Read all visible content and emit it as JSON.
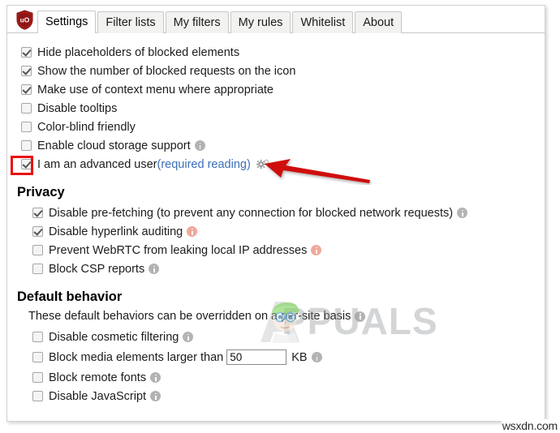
{
  "window": {
    "app_name": "uBlock Origin",
    "logo_icon": "ublock-shield-icon"
  },
  "tabs": [
    {
      "label": "Settings",
      "active": true,
      "name": "tab-settings"
    },
    {
      "label": "Filter lists",
      "active": false,
      "name": "tab-filter-lists"
    },
    {
      "label": "My filters",
      "active": false,
      "name": "tab-my-filters"
    },
    {
      "label": "My rules",
      "active": false,
      "name": "tab-my-rules"
    },
    {
      "label": "Whitelist",
      "active": false,
      "name": "tab-whitelist"
    },
    {
      "label": "About",
      "active": false,
      "name": "tab-about"
    }
  ],
  "general_options": [
    {
      "label": "Hide placeholders of blocked elements",
      "checked": true,
      "info": "none"
    },
    {
      "label": "Show the number of blocked requests on the icon",
      "checked": true,
      "info": "none"
    },
    {
      "label": "Make use of context menu where appropriate",
      "checked": true,
      "info": "none"
    },
    {
      "label": "Disable tooltips",
      "checked": false,
      "info": "none"
    },
    {
      "label": "Color-blind friendly",
      "checked": false,
      "info": "none"
    },
    {
      "label": "Enable cloud storage support",
      "checked": false,
      "info": "gray"
    }
  ],
  "advanced_user": {
    "label_prefix": "I am an advanced user ",
    "link_text": "(required reading)",
    "checked": true,
    "gear_icon": "gears-icon",
    "highlighted": true
  },
  "privacy": {
    "heading": "Privacy",
    "options": [
      {
        "label": "Disable pre-fetching (to prevent any connection for blocked network requests)",
        "checked": true,
        "info": "gray"
      },
      {
        "label": "Disable hyperlink auditing",
        "checked": true,
        "info": "warn"
      },
      {
        "label": "Prevent WebRTC from leaking local IP addresses",
        "checked": false,
        "info": "warn"
      },
      {
        "label": "Block CSP reports",
        "checked": false,
        "info": "gray"
      }
    ]
  },
  "default_behavior": {
    "heading": "Default behavior",
    "note": "These default behaviors can be overridden on a per-site basis",
    "note_info": "gray",
    "options": [
      {
        "label": "Disable cosmetic filtering",
        "checked": false,
        "info": "gray"
      },
      {
        "label": "Block remote fonts",
        "checked": false,
        "info": "gray"
      },
      {
        "label": "Disable JavaScript",
        "checked": false,
        "info": "gray"
      }
    ],
    "media_rule": {
      "label": "Block media elements larger than",
      "checked": false,
      "value": "50",
      "unit": "KB",
      "info": "gray"
    }
  },
  "annotations": {
    "highlight_color": "#e81111",
    "arrow_color": "#cf0b0b",
    "arrow_name": "red-arrow-pointing-left"
  },
  "watermarks": {
    "brand": "PPUALS",
    "brand_full": "APPUALS",
    "site": "wsxdn.com"
  }
}
